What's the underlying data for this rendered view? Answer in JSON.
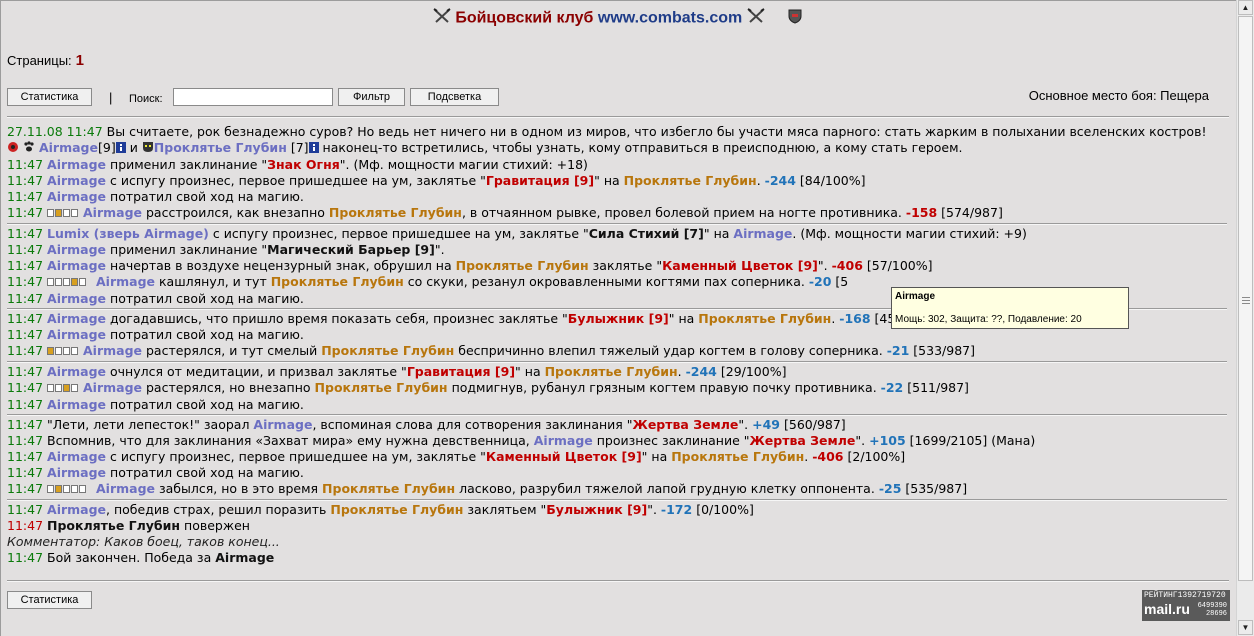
{
  "header": {
    "title": "Бойцовский клуб",
    "site": "www.combats.com"
  },
  "pages": {
    "label": "Страницы:",
    "current": "1"
  },
  "toolbar": {
    "stats_button": "Статистика",
    "separator": "|",
    "search_label": "Поиск:",
    "search_value": "",
    "filter_button": "Фильтр",
    "highlight_button": "Подсветка",
    "place_text": "Основное место боя: Пещера"
  },
  "intro": {
    "date": "27.11.08",
    "time": "11:47",
    "text": "Вы считаете, рок безнадежно суров? Но ведь нет ничего ни в одном из миров, что избегло бы участи мяса парного: стать жарким в полыхании вселенских костров!",
    "p1": "Airmage",
    "p1_level": "[9]",
    "and": "и",
    "p2": "Проклятье Глубин",
    "p2_level": "[7]",
    "rest": "наконец-то встретились, чтобы узнать, кому отправиться в преисподнюю, а кому стать героем."
  },
  "log": {
    "l1": {
      "time": "11:47",
      "who": "Airmage",
      "a": "применил заклинание \"",
      "spell": "Знак Огня",
      "b": "\". (Мф. мощности магии стихий: +18)"
    },
    "l2": {
      "time": "11:47",
      "who": "Airmage",
      "a": "с испугу произнес, первое пришедшее на ум, заклятье \"",
      "spell": "Гравитация [9]",
      "b": "\" на",
      "target": "Проклятье Глубин",
      "num": "-244",
      "c": "[84/100%]"
    },
    "l3": {
      "time": "11:47",
      "who": "Airmage",
      "a": "потратил свой ход на магию."
    },
    "l4": {
      "time": "11:47",
      "who": "Airmage",
      "a": "расстроился, как внезапно",
      "target": "Проклятье Глубин",
      "b": ", в отчаянном рывке, провел болевой прием на ногте противника.",
      "num": "-158",
      "c": "[574/987]"
    },
    "l5": {
      "time": "11:47",
      "who": "Lumix (зверь Airmage)",
      "a": "с испугу произнес, первое пришедшее на ум, заклятье \"",
      "spell": "Сила Стихий [7]",
      "b": "\" на",
      "target": "Airmage",
      "c": ". (Мф. мощности магии стихий: +9)"
    },
    "l6": {
      "time": "11:47",
      "who": "Airmage",
      "a": "применил заклинание \"",
      "spell": "Магический Барьер [9]",
      "b": "\"."
    },
    "l7": {
      "time": "11:47",
      "who": "Airmage",
      "a": "начертав в воздухе нецензурный знак, обрушил на",
      "target": "Проклятье Глубин",
      "b": "заклятье \"",
      "spell": "Каменный Цветок [9]",
      "c": "\".",
      "num": "-406",
      "d": "[57/100%]"
    },
    "l8": {
      "time": "11:47",
      "who": "Airmage",
      "a": "кашлянул, и тут",
      "target": "Проклятье Глубин",
      "b": "со скуки, резанул окровавленными когтями пах соперника.",
      "num": "-20",
      "c": "[5"
    },
    "l9": {
      "time": "11:47",
      "who": "Airmage",
      "a": "потратил свой ход на магию."
    },
    "l10": {
      "time": "11:47",
      "who": "Airmage",
      "a": "догадавшись, что пришло время показать себя, произнес заклятье \"",
      "spell": "Булыжник [9]",
      "b": "\" на",
      "target": "Проклятье Глубин",
      "num": "-168",
      "c": "[45/100%]"
    },
    "l11": {
      "time": "11:47",
      "who": "Airmage",
      "a": "потратил свой ход на магию."
    },
    "l12": {
      "time": "11:47",
      "who": "Airmage",
      "a": "растерялся, и тут смелый",
      "target": "Проклятье Глубин",
      "b": "беспричинно влепил тяжелый удар когтем в голову соперника.",
      "num": "-21",
      "c": "[533/987]"
    },
    "l13": {
      "time": "11:47",
      "who": "Airmage",
      "a": "очнулся от медитации, и призвал заклятье \"",
      "spell": "Гравитация [9]",
      "b": "\" на",
      "target": "Проклятье Глубин",
      "num": "-244",
      "c": "[29/100%]"
    },
    "l14": {
      "time": "11:47",
      "who": "Airmage",
      "a": "растерялся, но внезапно",
      "target": "Проклятье Глубин",
      "b": "подмигнув, рубанул грязным когтем правую почку противника.",
      "num": "-22",
      "c": "[511/987]"
    },
    "l15": {
      "time": "11:47",
      "who": "Airmage",
      "a": "потратил свой ход на магию."
    },
    "l16": {
      "time": "11:47",
      "a": "\"Лети, лети лепесток!\" заорал",
      "who": "Airmage",
      "b": ", вспоминая слова для сотворения заклинания \"",
      "spell": "Жертва Земле",
      "c": "\".",
      "num": "+49",
      "d": "[560/987]"
    },
    "l17": {
      "time": "11:47",
      "a": "Вспомнив, что для заклинания «Захват мира» ему нужна девственница,",
      "who": "Airmage",
      "b": "произнес заклинание \"",
      "spell": "Жертва Земле",
      "c": "\".",
      "num": "+105",
      "d": "[1699/2105] (Мана)"
    },
    "l18": {
      "time": "11:47",
      "who": "Airmage",
      "a": "с испугу произнес, первое пришедшее на ум, заклятье \"",
      "spell": "Каменный Цветок [9]",
      "b": "\" на",
      "target": "Проклятье Глубин",
      "num": "-406",
      "c": "[2/100%]"
    },
    "l19": {
      "time": "11:47",
      "who": "Airmage",
      "a": "потратил свой ход на магию."
    },
    "l20": {
      "time": "11:47",
      "who": "Airmage",
      "a": "забылся, но в это время",
      "target": "Проклятье Глубин",
      "b": "ласково, разрубил тяжелой лапой грудную клетку оппонента.",
      "num": "-25",
      "c": "[535/987]"
    },
    "l21": {
      "time": "11:47",
      "who": "Airmage",
      "a": ", победив страх, решил поразить",
      "target": "Проклятье Глубин",
      "b": "заклятьем \"",
      "spell": "Булыжник [9]",
      "c": "\".",
      "num": "-172",
      "d": "[0/100%]"
    },
    "l22": {
      "time": "11:47",
      "who": "Проклятье Глубин",
      "a": "повержен"
    },
    "l23": {
      "text": "Комментатор: Каков боец, таков конец..."
    },
    "l24": {
      "time": "11:47",
      "a": "Бой закончен. Победа за",
      "who": "Airmage"
    }
  },
  "tooltip": {
    "name": "Airmage",
    "stats": "Мощь: 302, Защита: ??, Подавление: 20"
  },
  "footer": {
    "stats_button": "Статистика"
  },
  "rating": {
    "label": "РЕЙТИНГ",
    "id": "1392719720",
    "brand": "mail.ru",
    "n1": "6499390",
    "n2": "28696"
  },
  "colors": {
    "player1": "#6c6fc2",
    "player2": "#b8760d",
    "spell": "#c00000",
    "number": "#2173b8",
    "time": "#0a7a0a"
  }
}
